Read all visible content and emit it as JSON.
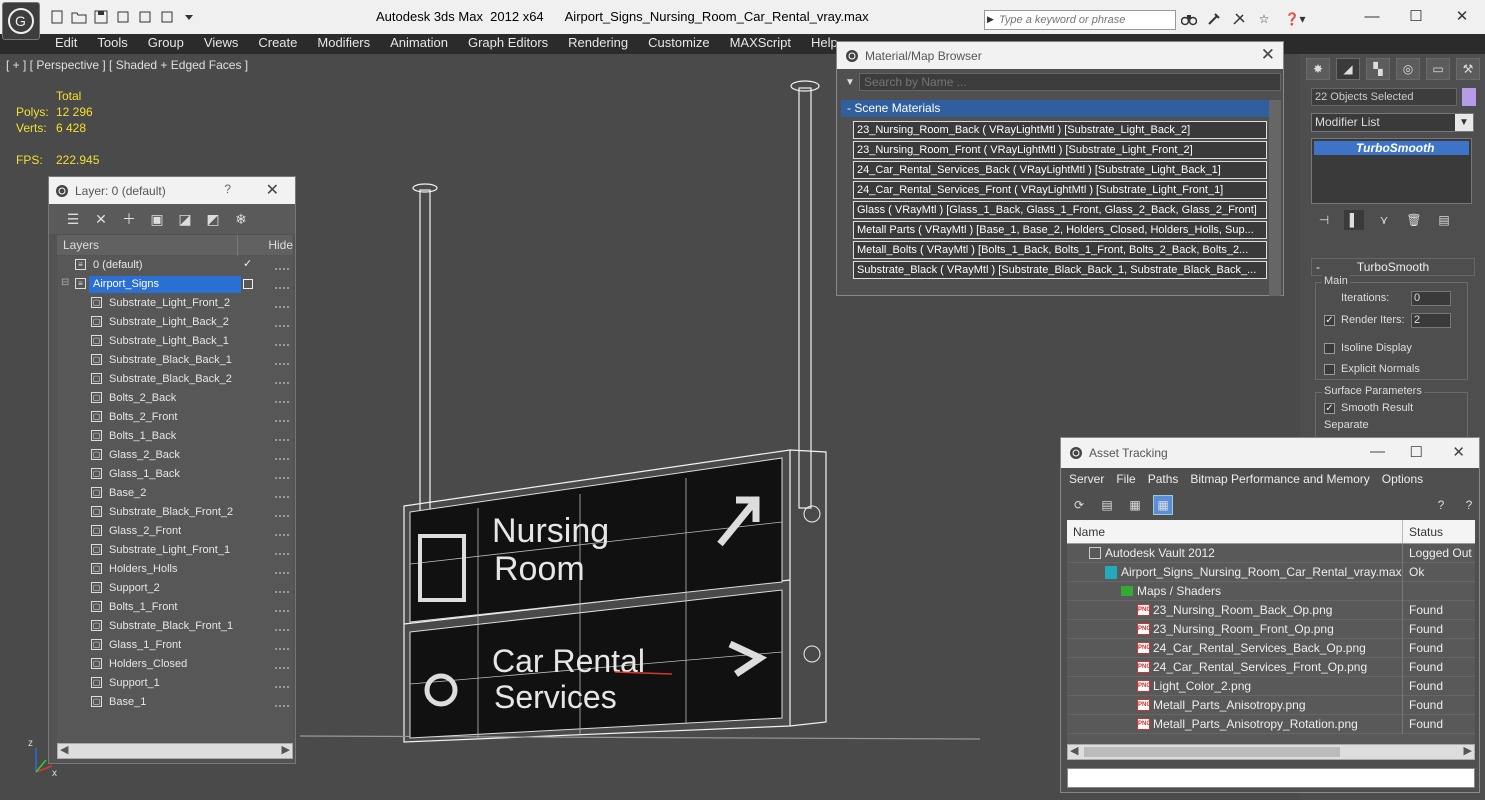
{
  "app": {
    "product": "Autodesk 3ds Max  2012 x64",
    "file": "Airport_Signs_Nursing_Room_Car_Rental_vray.max",
    "search_placeholder": "Type a keyword or phrase"
  },
  "menu": [
    "Edit",
    "Tools",
    "Group",
    "Views",
    "Create",
    "Modifiers",
    "Animation",
    "Graph Editors",
    "Rendering",
    "Customize",
    "MAXScript",
    "Help"
  ],
  "viewport": {
    "label": "[ + ] [ Perspective ] [ Shaded + Edged Faces ]",
    "stats": {
      "total_label": "Total",
      "polys_label": "Polys:",
      "polys": "12 296",
      "verts_label": "Verts:",
      "verts": "6 428",
      "fps_label": "FPS:",
      "fps": "222.945"
    },
    "sign_text": {
      "top_line1": "Nursing",
      "top_line2": "Room",
      "bottom_line1": "Car Rental",
      "bottom_line2": "Services"
    },
    "axis_labels": {
      "z": "z",
      "x": "x"
    }
  },
  "layer_window": {
    "title": "Layer: 0 (default)",
    "help": "?",
    "col_layers": "Layers",
    "col_hide": "Hide",
    "rows": [
      {
        "name": "0 (default)",
        "level": 0,
        "check": "✓"
      },
      {
        "name": "Airport_Signs",
        "level": 0,
        "selected": true
      },
      {
        "name": "Substrate_Light_Front_2",
        "level": 1
      },
      {
        "name": "Substrate_Light_Back_2",
        "level": 1
      },
      {
        "name": "Substrate_Light_Back_1",
        "level": 1
      },
      {
        "name": "Substrate_Black_Back_1",
        "level": 1
      },
      {
        "name": "Substrate_Black_Back_2",
        "level": 1
      },
      {
        "name": "Bolts_2_Back",
        "level": 1
      },
      {
        "name": "Bolts_2_Front",
        "level": 1
      },
      {
        "name": "Bolts_1_Back",
        "level": 1
      },
      {
        "name": "Glass_2_Back",
        "level": 1
      },
      {
        "name": "Glass_1_Back",
        "level": 1
      },
      {
        "name": "Base_2",
        "level": 1
      },
      {
        "name": "Substrate_Black_Front_2",
        "level": 1
      },
      {
        "name": "Glass_2_Front",
        "level": 1
      },
      {
        "name": "Substrate_Light_Front_1",
        "level": 1
      },
      {
        "name": "Holders_Holls",
        "level": 1
      },
      {
        "name": "Support_2",
        "level": 1
      },
      {
        "name": "Bolts_1_Front",
        "level": 1
      },
      {
        "name": "Substrate_Black_Front_1",
        "level": 1
      },
      {
        "name": "Glass_1_Front",
        "level": 1
      },
      {
        "name": "Holders_Closed",
        "level": 1
      },
      {
        "name": "Support_1",
        "level": 1
      },
      {
        "name": "Base_1",
        "level": 1
      }
    ]
  },
  "material_browser": {
    "title": "Material/Map Browser",
    "search_placeholder": "Search by Name ...",
    "group": "- Scene Materials",
    "items": [
      "23_Nursing_Room_Back ( VRayLightMtl ) [Substrate_Light_Back_2]",
      "23_Nursing_Room_Front ( VRayLightMtl ) [Substrate_Light_Front_2]",
      "24_Car_Rental_Services_Back ( VRayLightMtl ) [Substrate_Light_Back_1]",
      "24_Car_Rental_Services_Front ( VRayLightMtl ) [Substrate_Light_Front_1]",
      "Glass ( VRayMtl ) [Glass_1_Back, Glass_1_Front, Glass_2_Back, Glass_2_Front]",
      "Metall Parts ( VRayMtl ) [Base_1, Base_2, Holders_Closed, Holders_Holls, Sup...",
      "Metall_Bolts ( VRayMtl ) [Bolts_1_Back, Bolts_1_Front, Bolts_2_Back, Bolts_2...",
      "Substrate_Black ( VRayMtl ) [Substrate_Black_Back_1, Substrate_Black_Back_..."
    ]
  },
  "command_panel": {
    "selection": "22 Objects Selected",
    "selection_color": "#b59ce6",
    "modifier_list": "Modifier List",
    "stack_item": "TurboSmooth",
    "rollout_title": "TurboSmooth",
    "main_group": "Main",
    "iterations_label": "Iterations:",
    "iterations": "0",
    "render_iters_label": "Render Iters:",
    "render_iters": "2",
    "isoline_label": "Isoline Display",
    "explicit_label": "Explicit Normals",
    "surface_group": "Surface Parameters",
    "smooth_label": "Smooth Result",
    "separate_label": "Separate"
  },
  "asset_tracking": {
    "title": "Asset Tracking",
    "menu": [
      "Server",
      "File",
      "Paths",
      "Bitmap Performance and Memory",
      "Options"
    ],
    "col_name": "Name",
    "col_status": "Status",
    "rows": [
      {
        "name": "Autodesk Vault 2012",
        "status": "Logged Out",
        "indent": 0,
        "icon": "vault"
      },
      {
        "name": "Airport_Signs_Nursing_Room_Car_Rental_vray.max",
        "status": "Ok",
        "indent": 1,
        "icon": "max"
      },
      {
        "name": "Maps / Shaders",
        "status": "",
        "indent": 2,
        "icon": "folder"
      },
      {
        "name": "23_Nursing_Room_Back_Op.png",
        "status": "Found",
        "indent": 3,
        "icon": "png"
      },
      {
        "name": "23_Nursing_Room_Front_Op.png",
        "status": "Found",
        "indent": 3,
        "icon": "png"
      },
      {
        "name": "24_Car_Rental_Services_Back_Op.png",
        "status": "Found",
        "indent": 3,
        "icon": "png"
      },
      {
        "name": "24_Car_Rental_Services_Front_Op.png",
        "status": "Found",
        "indent": 3,
        "icon": "png"
      },
      {
        "name": "Light_Color_2.png",
        "status": "Found",
        "indent": 3,
        "icon": "png"
      },
      {
        "name": "Metall_Parts_Anisotropy.png",
        "status": "Found",
        "indent": 3,
        "icon": "png"
      },
      {
        "name": "Metall_Parts_Anisotropy_Rotation.png",
        "status": "Found",
        "indent": 3,
        "icon": "png"
      }
    ]
  }
}
